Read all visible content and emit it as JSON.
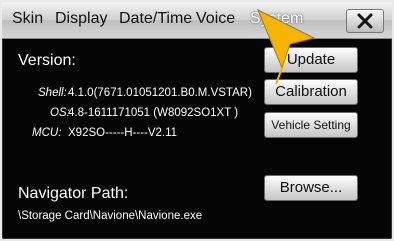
{
  "tabs": [
    {
      "label": "Skin"
    },
    {
      "label": "Display"
    },
    {
      "label": "Date/Time"
    },
    {
      "label": "Voice"
    },
    {
      "label": "System"
    }
  ],
  "system": {
    "version_label": "Version:",
    "shell_label": "Shell:",
    "shell_value": "4.1.0(7671.01051201.B0.M.VSTAR)",
    "os_label": "OS:",
    "os_value": "4.8-1611171051 (W8092SO1XT  )",
    "mcu_label": "MCU:",
    "mcu_value": "X92SO-----H----V2.11",
    "navigator_path_label": "Navigator Path:",
    "navigator_path_value": "\\Storage Card\\Navione\\Navione.exe"
  },
  "buttons": {
    "update": "Update",
    "calibration": "Calibration",
    "vehicle_setting": "Vehicle Setting",
    "browse": "Browse..."
  },
  "icons": {
    "close": "close-icon",
    "pointer": "arrow-cursor-icon"
  },
  "colors": {
    "accent_arrow": "#f4b400",
    "background": "#050505"
  }
}
